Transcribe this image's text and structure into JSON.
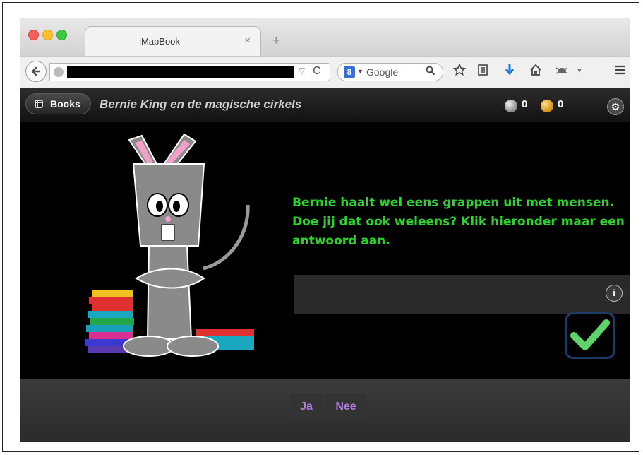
{
  "browser": {
    "tab_title": "iMapBook",
    "tab_close": "×",
    "new_tab": "+",
    "search_engine": "Google",
    "icons": [
      "back-arrow-icon",
      "globe-icon",
      "dropdown-icon",
      "reload-icon",
      "google-icon",
      "search-icon",
      "star-icon",
      "reading-list-icon",
      "download-icon",
      "home-icon",
      "extension-icon",
      "menu-icon"
    ]
  },
  "app": {
    "books_label": "Books",
    "book_title": "Bernie King en de magische cirkels",
    "silver_coins": "0",
    "gold_coins": "0",
    "question": "Bernie haalt wel eens grappen uit met mensen. Doe jij dat ook weleens? Klik hieronder maar een antwoord aan.",
    "answers": [
      "Ja",
      "Nee"
    ],
    "colors": {
      "question_text": "#2bd42b",
      "answer_text": "#b47be0",
      "check_green": "#5dd36a",
      "check_border": "#1b3c66"
    }
  }
}
